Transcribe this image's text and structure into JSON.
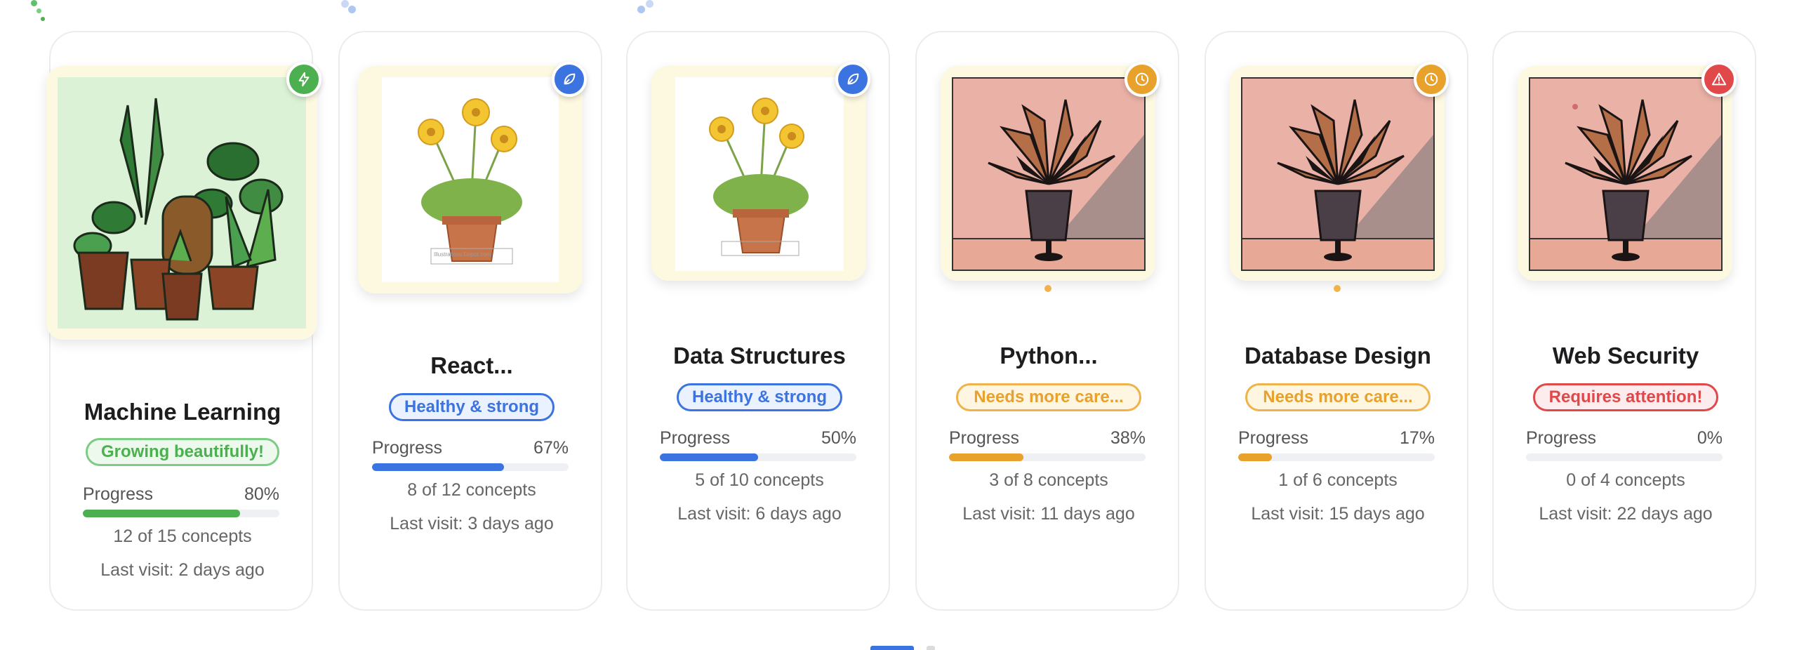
{
  "cards": [
    {
      "title": "Machine Learning",
      "status": "Growing beautifully!",
      "progress_label": "Progress",
      "progress_text": "80%",
      "progress": 0.8,
      "concepts": "12 of 15 concepts",
      "last_visit": "Last visit: 2 days ago",
      "icon": "lightning-icon",
      "accent": "#4caf50"
    },
    {
      "title": "React...",
      "status": "Healthy & strong",
      "progress_label": "Progress",
      "progress_text": "67%",
      "progress": 0.67,
      "concepts": "8 of 12 concepts",
      "last_visit": "Last visit: 3 days ago",
      "icon": "leaf-icon",
      "accent": "#3b73e0"
    },
    {
      "title": "Data Structures",
      "status": "Healthy & strong",
      "progress_label": "Progress",
      "progress_text": "50%",
      "progress": 0.5,
      "concepts": "5 of 10 concepts",
      "last_visit": "Last visit: 6 days ago",
      "icon": "leaf-icon",
      "accent": "#3b73e0"
    },
    {
      "title": "Python...",
      "status": "Needs more care...",
      "progress_label": "Progress",
      "progress_text": "38%",
      "progress": 0.38,
      "concepts": "3 of 8 concepts",
      "last_visit": "Last visit: 11 days ago",
      "icon": "clock-icon",
      "accent": "#e8a12a"
    },
    {
      "title": "Database Design",
      "status": "Needs more care...",
      "progress_label": "Progress",
      "progress_text": "17%",
      "progress": 0.17,
      "concepts": "1 of 6 concepts",
      "last_visit": "Last visit: 15 days ago",
      "icon": "clock-icon",
      "accent": "#e8a12a"
    },
    {
      "title": "Web Security",
      "status": "Requires attention!",
      "progress_label": "Progress",
      "progress_text": "0%",
      "progress": 0.0,
      "concepts": "0 of 4 concepts",
      "last_visit": "Last visit: 22 days ago",
      "icon": "warning-icon",
      "accent": "#e0484a"
    }
  ],
  "image_caption": "Illustrations Depot.com",
  "pagination": {
    "pages": 2,
    "active": 1
  }
}
